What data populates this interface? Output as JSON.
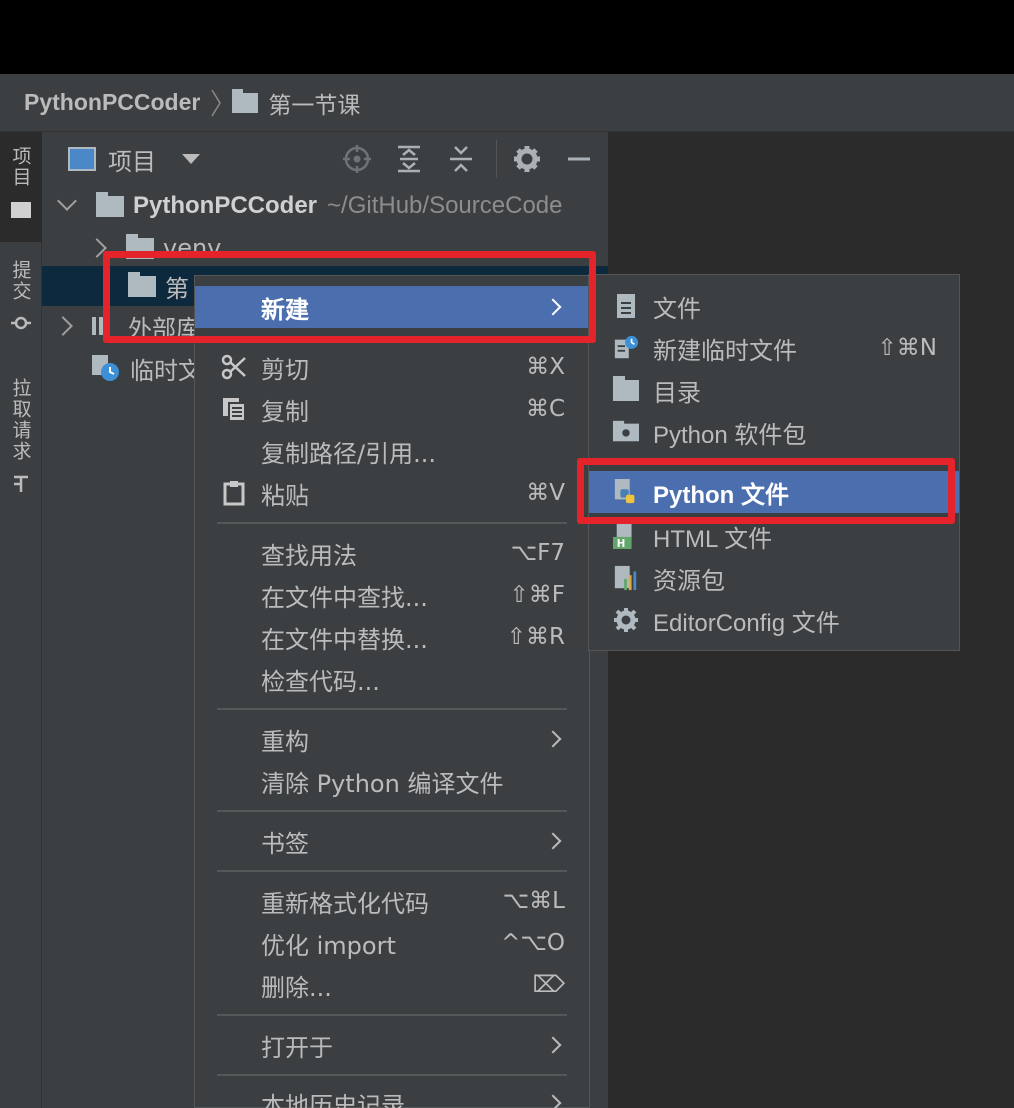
{
  "navbar": {
    "project": "PythonPCCoder",
    "folder": "第一节课"
  },
  "left_strip": {
    "project_tab": "项目",
    "commit_tab": "提交",
    "pull_tab": "拉取请求"
  },
  "project_panel": {
    "view_label": "项目",
    "tree": {
      "root_name": "PythonPCCoder",
      "root_path": "~/GitHub/SourceCode",
      "venv": "venv",
      "lesson": "第",
      "external": "外部库",
      "scratch": "临时文"
    }
  },
  "context_menu": {
    "new": "新建",
    "cut": "剪切",
    "cut_sc": "⌘X",
    "copy": "复制",
    "copy_sc": "⌘C",
    "copy_path": "复制路径/引用...",
    "paste": "粘贴",
    "paste_sc": "⌘V",
    "find_usages": "查找用法",
    "find_usages_sc": "⌥F7",
    "find_in_files": "在文件中查找...",
    "find_in_files_sc": "⇧⌘F",
    "replace_in_files": "在文件中替换...",
    "replace_in_files_sc": "⇧⌘R",
    "inspect": "检查代码...",
    "refactor": "重构",
    "clean_python": "清除 Python 编译文件",
    "bookmarks": "书签",
    "reformat": "重新格式化代码",
    "reformat_sc": "⌥⌘L",
    "optimize_import": "优化 import",
    "optimize_import_sc": "^⌥O",
    "delete": "删除...",
    "delete_sc": "⌦",
    "open_in": "打开于",
    "local_history": "本地历史记录"
  },
  "submenu": {
    "file": "文件",
    "scratch": "新建临时文件",
    "scratch_sc": "⇧⌘N",
    "directory": "目录",
    "python_package": "Python 软件包",
    "python_file": "Python 文件",
    "html_file": "HTML 文件",
    "resource_bundle": "资源包",
    "editorconfig": "EditorConfig 文件"
  },
  "colors": {
    "selection": "#4b6eaf",
    "annotation": "#e5232a",
    "panel": "#3c3f41",
    "editor": "#2b2b2b"
  }
}
